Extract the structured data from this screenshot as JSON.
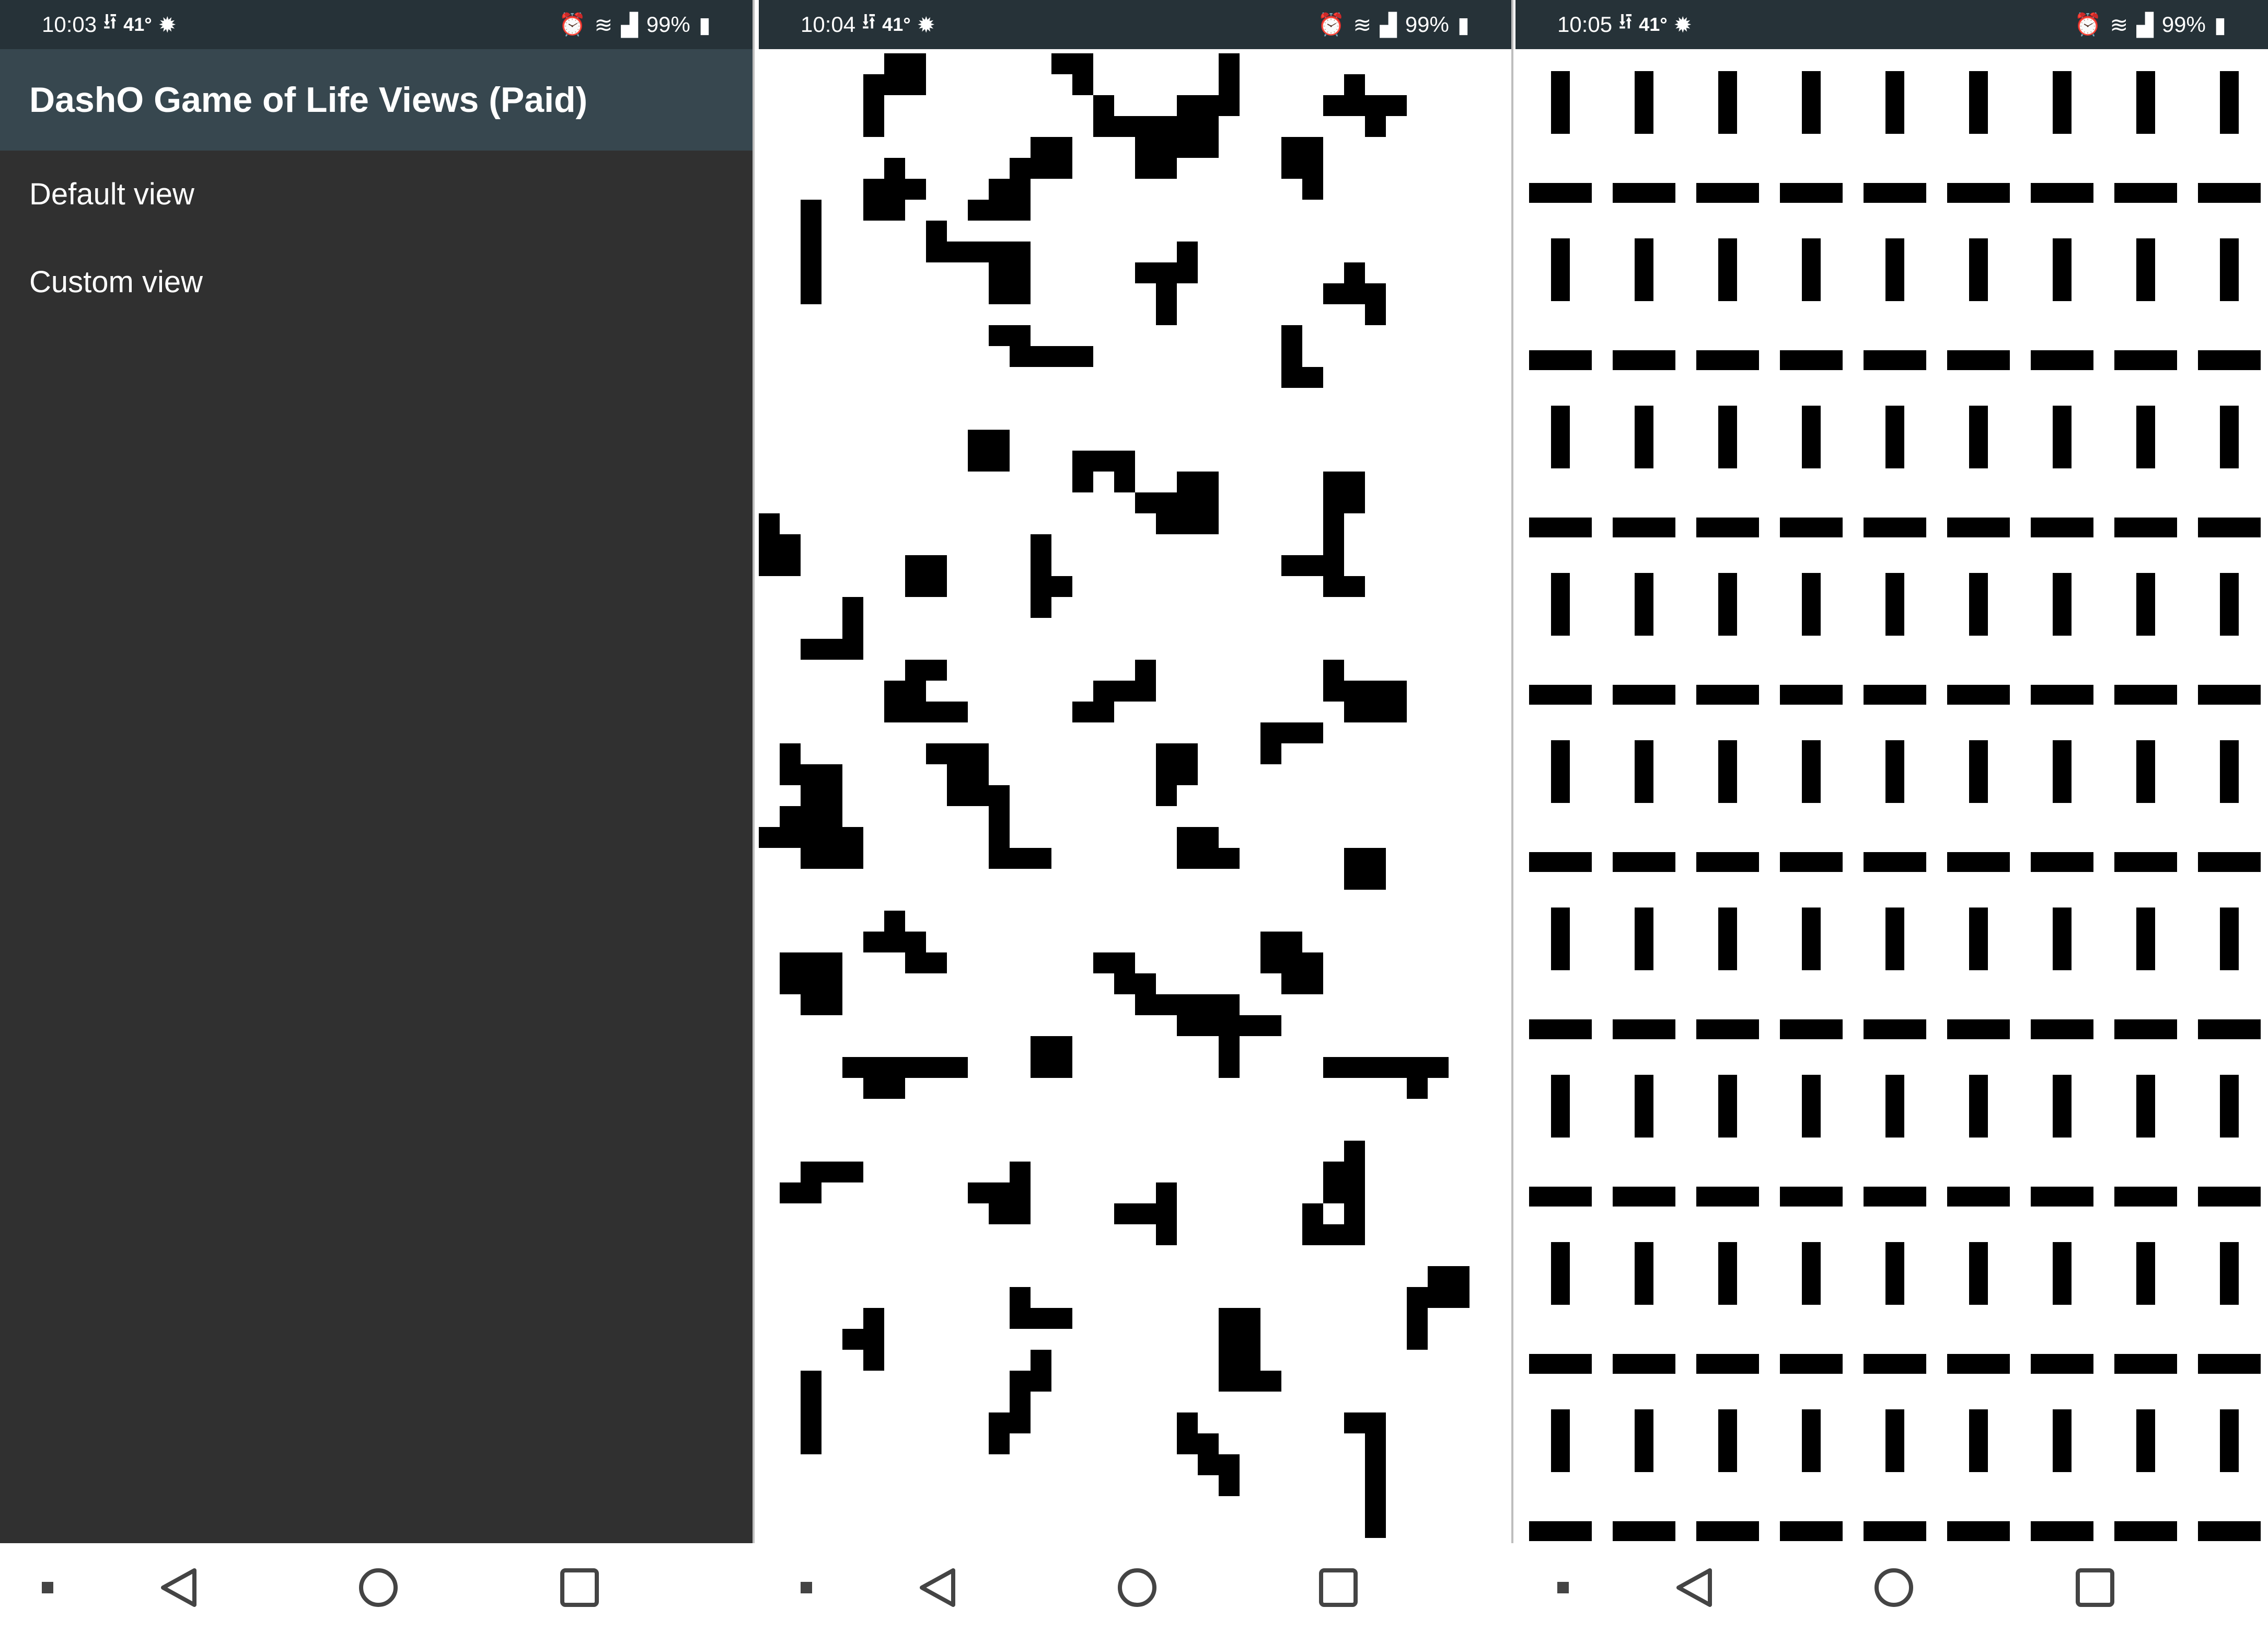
{
  "screens": [
    {
      "time": "10:03",
      "temp": "41°",
      "battery": "99%",
      "status_icons": [
        "usb-icon",
        "bug-icon",
        "alarm-icon",
        "wifi-icon",
        "signal-icon",
        "battery-icon"
      ],
      "app_title": "DashO Game of Life Views (Paid)",
      "menu_items": [
        {
          "label": "Default view"
        },
        {
          "label": "Custom view"
        }
      ]
    },
    {
      "time": "10:04",
      "temp": "41°",
      "battery": "99%",
      "status_icons": [
        "usb-icon",
        "bug-icon",
        "alarm-icon",
        "wifi-icon",
        "signal-icon",
        "battery-icon"
      ],
      "view": "default-view",
      "cell_color": "#000000"
    },
    {
      "time": "10:05",
      "temp": "41°",
      "battery": "99%",
      "status_icons": [
        "usb-icon",
        "bug-icon",
        "alarm-icon",
        "wifi-icon",
        "signal-icon",
        "battery-icon"
      ],
      "view": "custom-view",
      "cell_color": "#000000"
    }
  ],
  "nav_icons": [
    "recents-dot-icon",
    "back-icon",
    "home-icon",
    "overview-icon"
  ],
  "colors": {
    "status_bar": "#263238",
    "app_bar": "#37474f",
    "menu_bg": "#303030",
    "cell": "#000000"
  }
}
